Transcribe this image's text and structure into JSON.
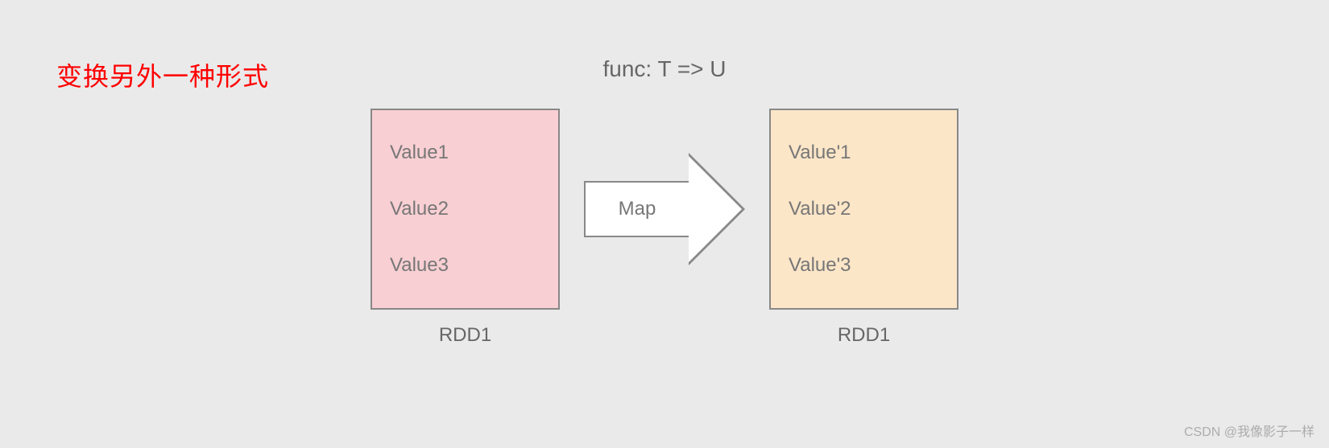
{
  "annotation": "变换另外一种形式",
  "func_label": "func: T => U",
  "left_box": {
    "values": [
      "Value1",
      "Value2",
      "Value3"
    ],
    "caption": "RDD1"
  },
  "arrow": {
    "label": "Map"
  },
  "right_box": {
    "values": [
      "Value'1",
      "Value'2",
      "Value'3"
    ],
    "caption": "RDD1"
  },
  "watermark": "CSDN @我像影子一样"
}
